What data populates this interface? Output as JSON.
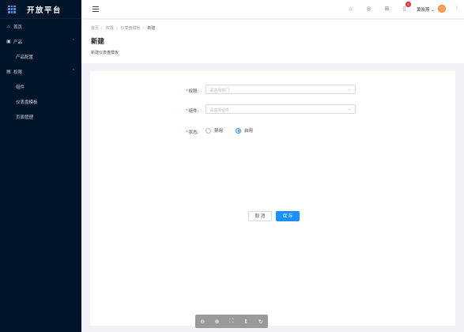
{
  "app": {
    "title": "开放平台"
  },
  "sidebar": {
    "items": [
      {
        "label": "首页",
        "icon": "home-icon"
      },
      {
        "label": "产品",
        "icon": "product-icon",
        "expanded": true
      },
      {
        "label": "产品配置",
        "sub": true
      },
      {
        "label": "权限",
        "icon": "permission-icon",
        "expanded": true
      },
      {
        "label": "组件",
        "sub": true
      },
      {
        "label": "仪表盘模板",
        "sub": true
      },
      {
        "label": "页面管理",
        "sub": true
      }
    ]
  },
  "header": {
    "notification_count": "6",
    "user_name": "黄晓燕",
    "icons": [
      "menu-fold-icon",
      "home-icon",
      "github-icon",
      "apps-icon",
      "bell-icon",
      "more-icon"
    ]
  },
  "breadcrumb": [
    "首页",
    "权限",
    "仪表盘模板",
    "新建"
  ],
  "page": {
    "title": "新建",
    "description": "新建仪表盘模板"
  },
  "form": {
    "fields": [
      {
        "label": "权限:",
        "placeholder": "请选择部门",
        "required": true
      },
      {
        "label": "组件:",
        "placeholder": "请选择组件",
        "required": true
      }
    ],
    "status": {
      "label": "状态:",
      "options": [
        {
          "label": "禁用",
          "selected": false
        },
        {
          "label": "启用",
          "selected": true
        }
      ]
    },
    "cancel_label": "取 消",
    "save_label": "保 存"
  },
  "colors": {
    "sidebar_bg": "#001529",
    "primary": "#1890ff",
    "danger": "#f5222d"
  }
}
